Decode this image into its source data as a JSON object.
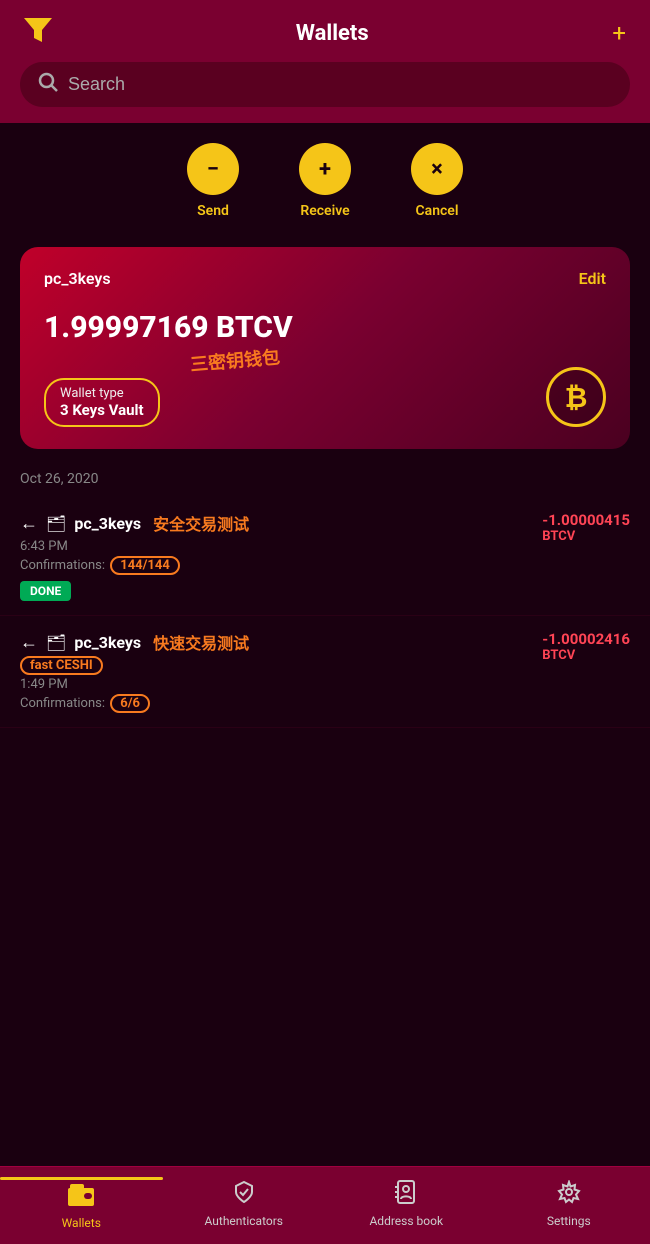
{
  "header": {
    "title": "Wallets",
    "filter_icon": "▼",
    "add_icon": "+"
  },
  "search": {
    "placeholder": "Search"
  },
  "actions": [
    {
      "id": "send",
      "icon": "−",
      "label": "Send"
    },
    {
      "id": "receive",
      "icon": "+",
      "label": "Receive"
    },
    {
      "id": "cancel",
      "icon": "×",
      "label": "Cancel"
    }
  ],
  "wallet_card": {
    "name": "pc_3keys",
    "edit_label": "Edit",
    "balance": "1.99997169 BTCV",
    "wallet_type_label": "Wallet type",
    "wallet_type_value": "3 Keys Vault",
    "chinese_annotation": "三密钥钱包"
  },
  "date_label": "Oct 26, 2020",
  "transactions": [
    {
      "arrow": "←",
      "wallet_icon": "🗂",
      "name": "pc_3keys",
      "chinese_label": "安全交易测试",
      "time": "6:43 PM",
      "confirmations_prefix": "Confirmations: ",
      "confirmations_value": "144/144",
      "status": "DONE",
      "amount": "-1.00000415",
      "currency": "BTCV"
    },
    {
      "arrow": "←",
      "wallet_icon": "🗂",
      "name": "pc_3keys",
      "fast_label": "fast CESHI",
      "chinese_label": "快速交易测试",
      "time": "1:49 PM",
      "confirmations_prefix": "Confirmations: ",
      "confirmations_value": "6/6",
      "status": "",
      "amount": "-1.00002416",
      "currency": "BTCV"
    }
  ],
  "bottom_nav": [
    {
      "id": "wallets",
      "icon": "▣",
      "label": "Wallets",
      "active": true
    },
    {
      "id": "authenticators",
      "icon": "🛡",
      "label": "Authenticators",
      "active": false
    },
    {
      "id": "address-book",
      "icon": "👤",
      "label": "Address book",
      "active": false
    },
    {
      "id": "settings",
      "icon": "⚙",
      "label": "Settings",
      "active": false
    }
  ],
  "colors": {
    "accent": "#f5c518",
    "negative": "#ff4455",
    "done": "#00aa55",
    "annotation": "#f87a1f",
    "header_bg": "#7a0030",
    "bg": "#1a0010"
  }
}
